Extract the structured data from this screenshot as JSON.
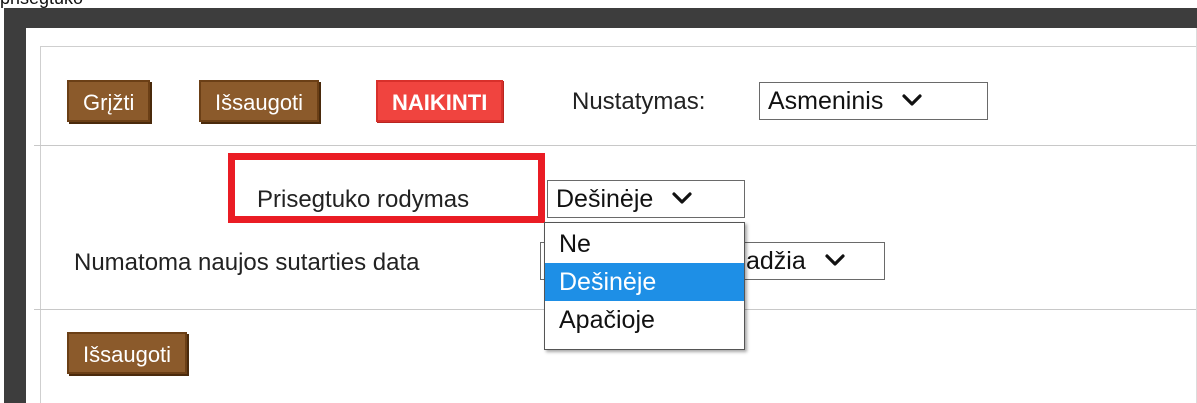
{
  "caption": "prisegtuko",
  "toolbar": {
    "back_label": "Grįžti",
    "save_label": "Išsaugoti",
    "delete_label": "NAIKINTI",
    "setting_label": "Nustatymas:",
    "setting_value": "Asmeninis"
  },
  "form": {
    "attachment_display_label": "Prisegtuko rodymas",
    "attachment_display_value": "Dešinėje",
    "new_contract_date_label": "Numatoma naujos sutarties data",
    "new_contract_date_value_visible": "adžia",
    "dropdown_options": [
      "Ne",
      "Dešinėje",
      "Apačioje"
    ],
    "dropdown_selected": "Dešinėje"
  },
  "footer": {
    "save_label": "Išsaugoti"
  },
  "colors": {
    "button_brown": "#8b5a2b",
    "button_red": "#f0443f",
    "highlight_red": "#ea1c24",
    "selected_blue": "#1e8fe6",
    "frame_dark": "#3d3d3d"
  }
}
